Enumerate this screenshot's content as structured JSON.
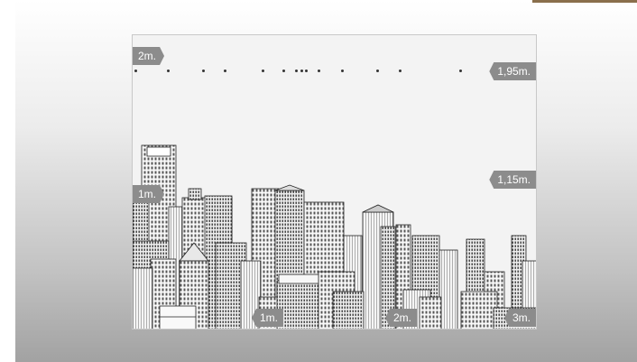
{
  "colors": {
    "marker_bg": "#8c8c8c",
    "marker_text": "#ffffff",
    "frame_bg": "#f3f3f3",
    "accent_tab": "#8a6f4c"
  },
  "height_scale": {
    "top_left": "2m.",
    "mid_left": "1m.",
    "top_right": "1,95m.",
    "mid_right": "1,15m."
  },
  "width_scale": {
    "first": "1m.",
    "second": "2m.",
    "third": "3m."
  },
  "illustration": "city-skyline-drawing"
}
